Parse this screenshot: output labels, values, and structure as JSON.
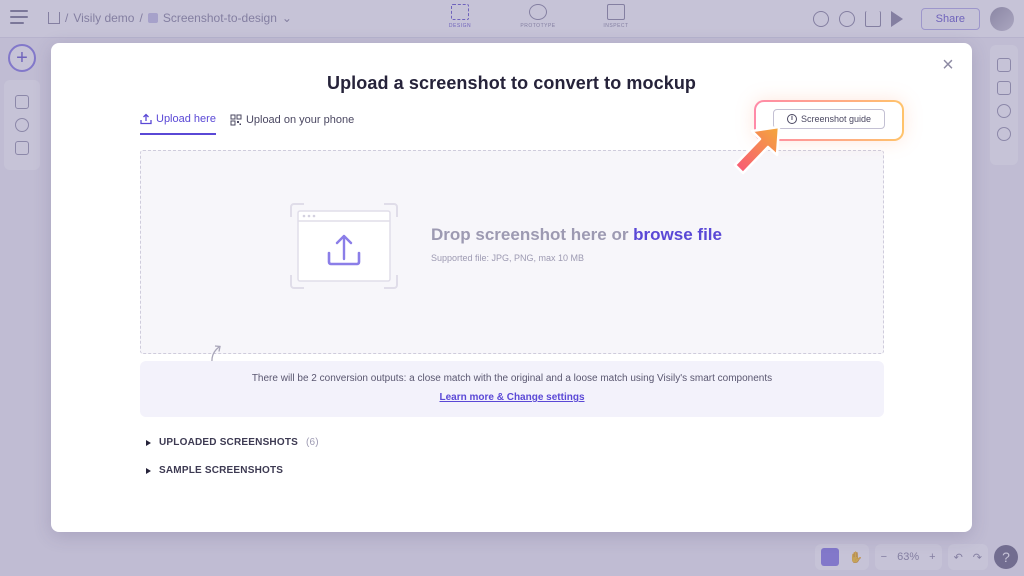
{
  "app": {
    "breadcrumb": [
      "Visily demo",
      "Screenshot-to-design"
    ],
    "modes": [
      {
        "label": "DESIGN",
        "active": true
      },
      {
        "label": "PROTOTYPE",
        "active": false
      },
      {
        "label": "INSPECT",
        "active": false
      }
    ],
    "share_label": "Share",
    "zoom_level": "63%",
    "help_label": "?"
  },
  "modal": {
    "title": "Upload a screenshot to convert to mockup",
    "close_label": "×",
    "tabs": [
      {
        "label": "Upload here",
        "icon": "upload-icon",
        "active": true
      },
      {
        "label": "Upload on your phone",
        "icon": "qr-code-icon",
        "active": false
      }
    ],
    "guide_button_label": "Screenshot guide",
    "dropzone": {
      "main_text": "Drop screenshot here or ",
      "link_text": "browse file",
      "sub_text": "Supported file: JPG, PNG, max 10 MB"
    },
    "info": {
      "text": "There will be 2 conversion outputs: a close match with the original and a loose match using Visily's smart components",
      "link": "Learn more & Change settings"
    },
    "sections": [
      {
        "label": "UPLOADED SCREENSHOTS",
        "count": "(6)"
      },
      {
        "label": "SAMPLE SCREENSHOTS",
        "count": ""
      }
    ]
  },
  "colors": {
    "accent": "#5a48d6",
    "overlay": "#c5c1d8",
    "highlight_gradient_start": "#ff8aa8",
    "highlight_gradient_end": "#ffc36b"
  }
}
